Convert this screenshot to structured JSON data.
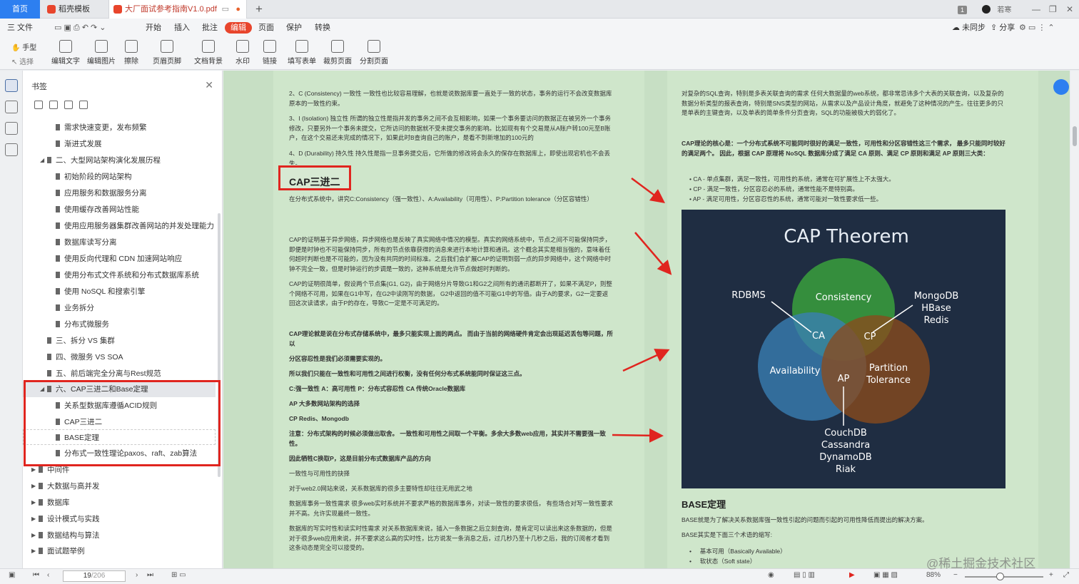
{
  "tabs": {
    "home": "首页",
    "template": "稻壳模板",
    "document": "大厂面试参考指南V1.0.pdf",
    "user": "若寒",
    "add": "+"
  },
  "window": {
    "minimize": "—",
    "restore": "❐",
    "close": "✕",
    "badge": "1"
  },
  "menu": {
    "file": "三 文件",
    "items": [
      "开始",
      "插入",
      "批注",
      "编辑",
      "页面",
      "保护",
      "转换"
    ],
    "right": [
      "未同步",
      "分享"
    ]
  },
  "toolbar": {
    "hand": "手型",
    "select": "选择",
    "tools": [
      "编辑文字",
      "编辑图片",
      "擦除",
      "页眉页脚",
      "文档背景",
      "水印",
      "链接",
      "填写表单",
      "裁剪页面",
      "分割页面"
    ]
  },
  "bookmarks": {
    "title": "书签",
    "items": [
      "需求快速变更，发布频繁",
      "渐进式发展",
      "二、大型网站架构演化发展历程",
      "初始阶段的网站架构",
      "应用服务和数据服务分离",
      "使用缓存改善网站性能",
      "使用应用服务器集群改善网站的并发处理能力",
      "数据库读写分离",
      "使用反向代理和 CDN 加速网站响应",
      "使用分布式文件系统和分布式数据库系统",
      "使用 NoSQL 和搜索引擎",
      "业务拆分",
      "分布式微服务",
      "三、拆分 VS 集群",
      "四、微服务 VS SOA",
      "五、前后端完全分离与Rest规范",
      "六、CAP三进二和Base定理",
      "关系型数据库遵循ACID规则",
      "CAP三进二",
      "BASE定理",
      "分布式一致性理论paxos、raft、zab算法",
      "中间件",
      "大数据与高并发",
      "数据库",
      "设计模式与实践",
      "数据结构与算法",
      "面试题举例"
    ]
  },
  "doc_left": {
    "p1": "2、C (Consistency) 一致性 一致性也比较容易理解，也就是说数据库要一直处于一致的状态，事务的运行不会改变数据库原本的一致性约束。",
    "p2": "3、I (Isolation) 独立性 所谓的独立性是指并发的事务之间不会互相影响，如果一个事务要访问的数据正在被另外一个事务修改，只要另外一个事务未提交，它所访问的数据就不受未提交事务的影响。比如现有有个交易是从A账户转100元至B账户，在这个交易还未完成的情况下，如果此时B查询自己的账户，是看不到新增加的100元的",
    "p3": "4、D (Durability) 持久性 持久性是指一旦事务提交后，它所做的修改将会永久的保存在数据库上，即使出现宕机也不会丢失。",
    "heading": "CAP三进二",
    "p4": "在分布式系统中，讲究C:Consistency（强一致性）、A:Availability（可用性）、P:Partition tolerance（分区容错性）",
    "p5": "CAP的证明基于异步网络，异步网络也是反映了真实网络中情况的模型。真实的网络系统中，节点之间不可能保持同步，即便是时钟也不可能保持同步，所有的节点依靠获得的消息来进行本地计算和通讯。这个概念其实是相当强的，意味着任何超时判断也是不可能的，因为没有共同的时间标准。之后我们会扩展CAP的证明到弱一点的异步网络中，这个网络中时钟不完全一致，但是时钟运行的步调是一致的，这种系统是允许节点做超时判断的。",
    "p6": "CAP的证明很简单，假设两个节点集{G1, G2}，由于网络分片导致G1和G2之间所有的通讯都断开了，如果不满足P，则整个网络不可用，如果在G1中写，在G2中读刚写的数据， G2中返回的值不可能G1中的写值。由于A的要求，G2一定要返回这次读请求，由于P的存在，导致C一定是不可满足的。",
    "b1": "CAP理论就是说在分布式存储系统中，最多只能实现上面的两点。 而由于当前的网络硬件肯定会出现延迟丢包等问题，所以",
    "b2": "分区容忍性是我们必须需要实现的。",
    "b3": "所以我们只能在一致性和可用性之间进行权衡，没有任何分布式系统能同时保证这三点。",
    "b4": "C:强一致性 A：高可用性 P：分布式容忍性 CA 传统Oracle数据库",
    "b5": "AP 大多数网站架构的选择",
    "b6": "CP Redis、Mongodb",
    "b7": "注意：分布式架构的时候必须做出取舍。 一致性和可用性之间取一个平衡。多余大多数web应用，其实并不需要强一致性。",
    "b8": "因此牺牲C换取P，这是目前分布式数据库产品的方向",
    "p7": "一致性与可用性的抉择",
    "p8": "对于web2.0网站来说，关系数据库的很多主要特性却往往无用武之地",
    "p9": "数据库事务一致性需求 很多web实时系统并不要求严格的数据库事务，对读一致性的要求很低， 有些场合对写一致性要求并不高。允许实现最终一致性。",
    "p10": "数据库的写实时性和读实时性需求    对关系数据库来说，插入一条数据之后立刻查询，是肯定可以读出来这条数据的，但是对于很多web应用来说，并不要求这么高的实时性，比方说发一条消息之后，过几秒乃至十几秒之后，我的订阅者才看到这条动态是完全可以接受的。"
  },
  "doc_right": {
    "p1": "对复杂的SQL查询，特别是多表关联查询的需求   任何大数据量的web系统，都非常忌讳多个大表的关联查询，以及复杂的数据分析类型的报表查询，特别是SNS类型的网站，从需求以及产品设计角度，就避免了这种情况的产生。往往更多的只是单表的主键查询，以及单表的简单条件分页查询，SQL的功能被极大的弱化了。",
    "core": "CAP理论的核心是：一个分布式系统不可能同时很好的满足一致性，可用性和分区容错性这三个需求， 最多只能同时较好的满足两个。 因此，根据 CAP 原理将 NoSQL 数据库分成了满足 CA 原则、满足 CP 原则和满足 AP 原则三大类：",
    "bullets": [
      "CA - 单点集群，满足一致性，可用性的系统，通常在可扩展性上不太强大。",
      "CP - 满足一致性，分区容忍必的系统，通常性能不是特别高。",
      "AP - 满足可用性，分区容忍性的系统，通常可能对一致性要求低一些。"
    ],
    "base_heading": "BASE定理",
    "base_p1": "BASE就是为了解决关系数据库强一致性引起的问题而引起的可用性降低而提出的解决方案。",
    "base_p2": "BASE其实是下面三个术语的缩写:",
    "base_items": [
      "基本可用（Basically Available）",
      "软状态（Soft state）"
    ]
  },
  "cap_figure": {
    "title": "CAP Theorem",
    "consistency": "Consistency",
    "availability": "Availability",
    "partition_1": "Partition",
    "partition_2": "Tolerance",
    "ca": "CA",
    "cp": "CP",
    "ap": "AP",
    "rdbms": "RDBMS",
    "cp_dbs": [
      "MongoDB",
      "HBase",
      "Redis"
    ],
    "ap_dbs": [
      "CouchDB",
      "Cassandra",
      "DynamoDB",
      "Riak"
    ],
    "colors": {
      "bg": "#1f2d42",
      "consistency": "#3aa03c",
      "availability": "#3a7fb5",
      "partition": "#8a4a1c"
    }
  },
  "status": {
    "page_current": "19",
    "page_total": "/206",
    "zoom": "88%",
    "watermark": "@稀土掘金技术社区"
  }
}
